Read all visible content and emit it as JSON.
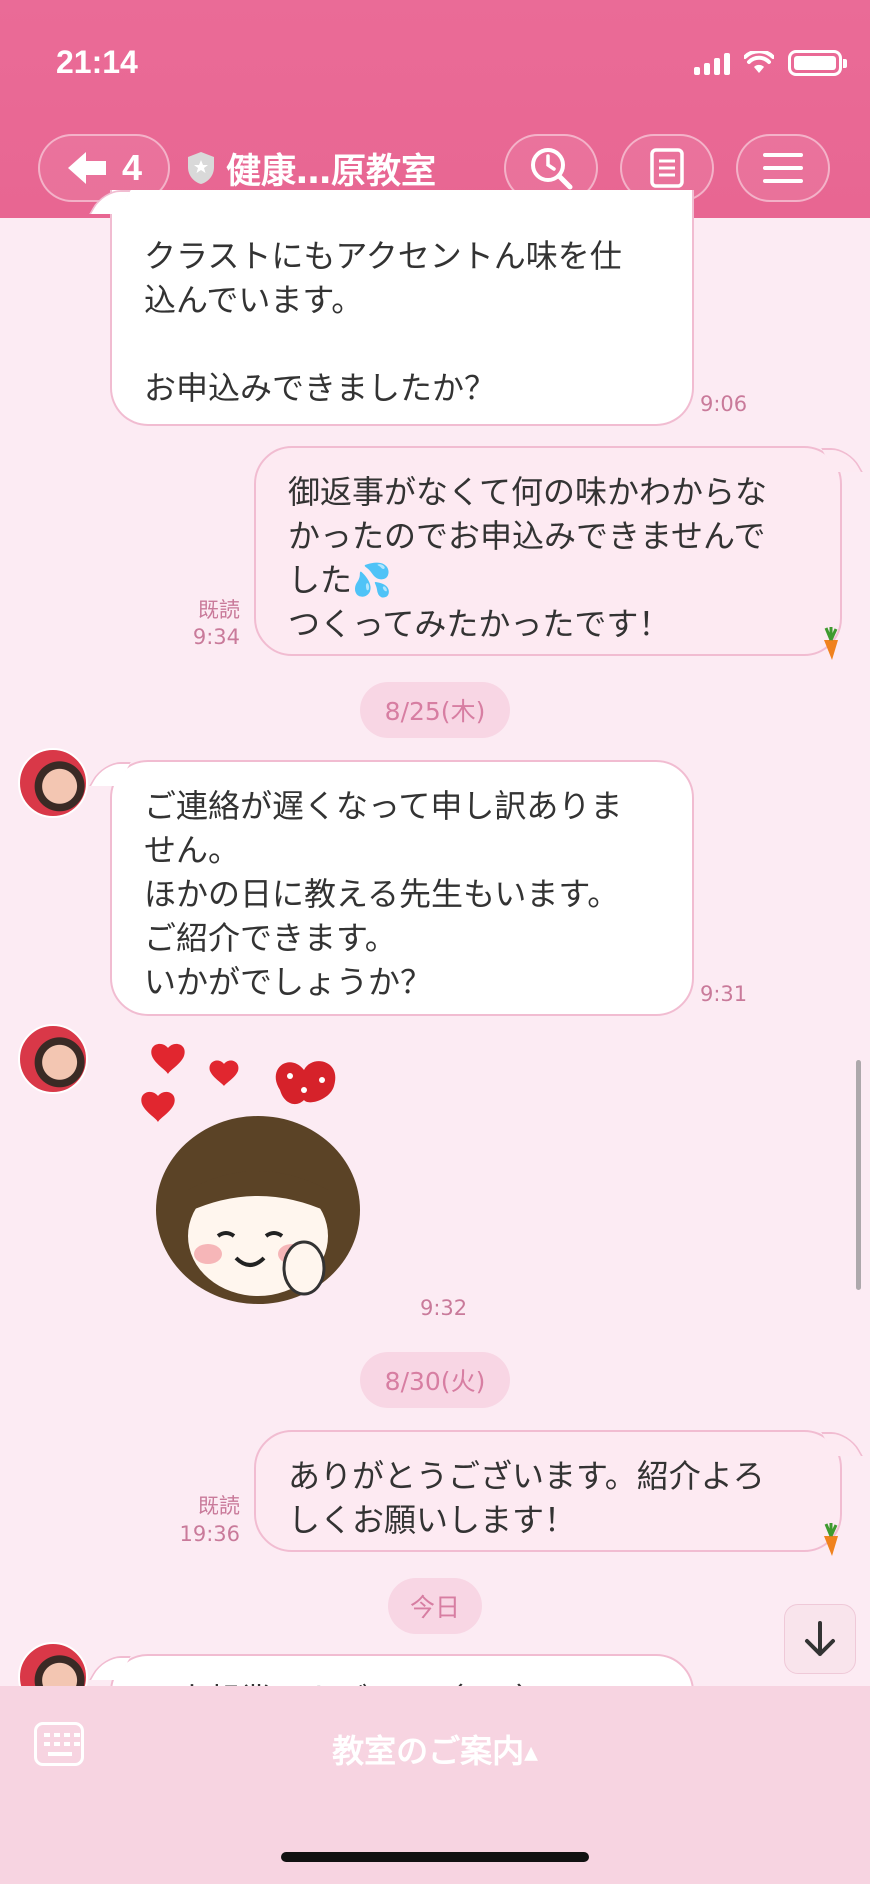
{
  "status_bar": {
    "time": "21:14"
  },
  "header": {
    "back_count": "4",
    "title": "健康…原教室",
    "search_icon": "clock-search-icon",
    "notes_icon": "note-icon",
    "menu_icon": "hamburger-icon"
  },
  "messages": [
    {
      "side": "theirs",
      "text": "クラストにもアクセントん味を仕\n込んでいます。\n\nお申込みできましたか？",
      "time": "9:06"
    },
    {
      "side": "mine",
      "text": "御返事がなくて何の味かわからな\nかったのでお申込みできませんで\nした💦\nつくってみたかったです！",
      "read": "既読",
      "time": "9:34"
    },
    {
      "type": "date",
      "label": "8/25(木)"
    },
    {
      "side": "theirs",
      "text": "ご連絡が遅くなって申し訳ありま\nせん。\nほかの日に教える先生もいます。\nご紹介できます。\nいかがでしょうか？",
      "time": "9:31"
    },
    {
      "side": "theirs",
      "type": "sticker",
      "time": "9:32"
    },
    {
      "type": "date",
      "label": "8/30(火)"
    },
    {
      "side": "mine",
      "text": "ありがとうございます。紹介よろ\nしくお願いします！",
      "read": "既読",
      "time": "19:36"
    },
    {
      "type": "date",
      "label": "今日"
    },
    {
      "side": "theirs",
      "text": "日本起業アカデミー（JKA）",
      "partial": true
    }
  ],
  "bottom": {
    "rich_menu_label": "教室のご案内",
    "caret": "▲"
  },
  "colors": {
    "header": "#ea6b97",
    "background": "#fcebf3",
    "bubble_border": "#f1bcd1",
    "meta": "#c97a9a"
  }
}
